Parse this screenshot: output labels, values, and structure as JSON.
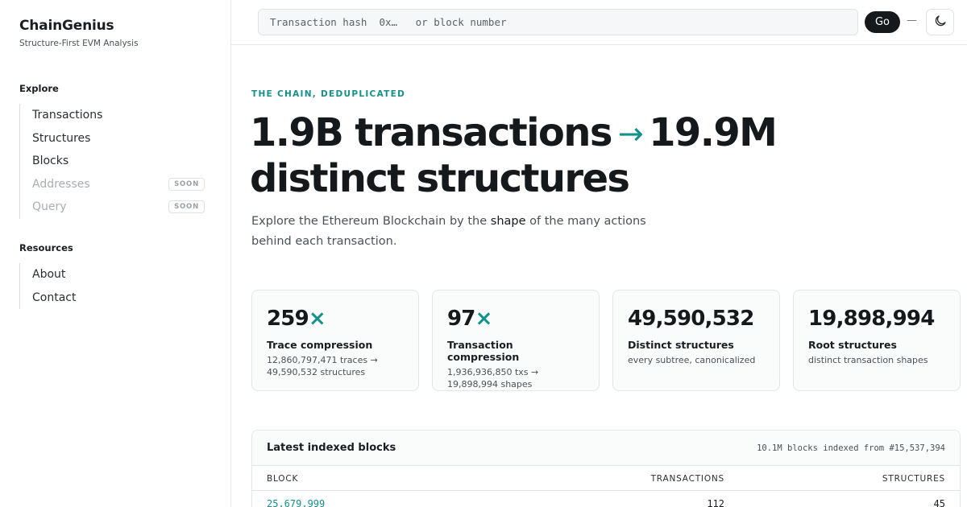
{
  "brand": {
    "title": "ChainGenius",
    "subtitle": "Structure-First EVM Analysis"
  },
  "sidebar": {
    "explore_heading": "Explore",
    "explore_items": [
      {
        "label": "Transactions",
        "enabled": true
      },
      {
        "label": "Structures",
        "enabled": true
      },
      {
        "label": "Blocks",
        "enabled": true
      },
      {
        "label": "Addresses",
        "enabled": false,
        "badge": "SOON"
      },
      {
        "label": "Query",
        "enabled": false,
        "badge": "SOON"
      }
    ],
    "resources_heading": "Resources",
    "resources_items": [
      {
        "label": "About"
      },
      {
        "label": "Contact"
      }
    ]
  },
  "topbar": {
    "search_placeholder": "Transaction hash  0x…   or block number",
    "go_label": "Go",
    "separator": "—",
    "theme_icon": "moon-icon"
  },
  "hero": {
    "eyebrow": "THE CHAIN, DEDUPLICATED",
    "headline_from": "1.9B transactions",
    "arrow": "→",
    "headline_to_1": "19.9M",
    "headline_to_2": "distinct structures",
    "intro_before": "Explore the Ethereum Blockchain by the ",
    "intro_emphasis": "shape",
    "intro_after": " of the many actions behind each transaction."
  },
  "stats": [
    {
      "value": "259",
      "suffix": "×",
      "label": "Trace compression",
      "sub": "12,860,797,471 traces → 49,590,532 structures"
    },
    {
      "value": "97",
      "suffix": "×",
      "label": "Transaction compression",
      "sub": "1,936,936,850 txs → 19,898,994 shapes"
    },
    {
      "value": "49,590,532",
      "suffix": "",
      "label": "Distinct structures",
      "sub": "every subtree, canonicalized"
    },
    {
      "value": "19,898,994",
      "suffix": "",
      "label": "Root structures",
      "sub": "distinct transaction shapes"
    }
  ],
  "blocks_table": {
    "title": "Latest indexed blocks",
    "meta": "10.1M blocks indexed from #15,537,394",
    "columns": [
      "BLOCK",
      "TRANSACTIONS",
      "STRUCTURES"
    ],
    "rows": [
      {
        "block": "25,679,999",
        "transactions": "112",
        "structures": "45"
      }
    ]
  },
  "colors": {
    "accent": "#14918a",
    "text": "#16191c",
    "muted": "#4b5157",
    "border": "#e3e6e8"
  }
}
